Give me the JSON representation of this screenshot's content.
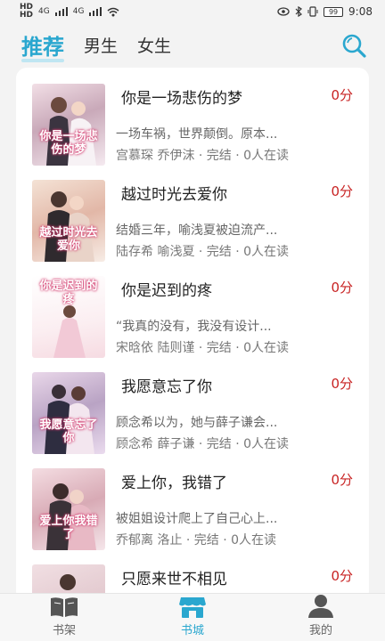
{
  "status_bar": {
    "left": [
      "HD",
      "4G",
      "4G"
    ],
    "battery": "99",
    "time": "9:08"
  },
  "header": {
    "tabs": [
      {
        "label": "推荐",
        "active": true
      },
      {
        "label": "男生",
        "active": false
      },
      {
        "label": "女生",
        "active": false
      }
    ],
    "accent_color": "#2aa7cf"
  },
  "books": [
    {
      "title": "你是一场悲伤的梦",
      "price": "0分",
      "desc": "一场车祸，世界颠倒。原本...",
      "meta": "宫慕琛 乔伊沫 · 完结 · 0人在读",
      "cover_text": "你是一场悲伤的梦"
    },
    {
      "title": "越过时光去爱你",
      "price": "0分",
      "desc": "结婚三年，喻浅夏被迫流产...",
      "meta": "陆存希 喻浅夏 · 完结 · 0人在读",
      "cover_text": "越过时光去爱你"
    },
    {
      "title": "你是迟到的疼",
      "price": "0分",
      "desc": "“我真的没有，我没有设计...",
      "meta": "宋晗依 陆则谨 · 完结 · 0人在读",
      "cover_text": "你是迟到的疼"
    },
    {
      "title": "我愿意忘了你",
      "price": "0分",
      "desc": "顾念希以为，她与薛子谦会...",
      "meta": "顾念希 薛子谦 · 完结 · 0人在读",
      "cover_text": "我愿意忘了你"
    },
    {
      "title": "爱上你，我错了",
      "price": "0分",
      "desc": "被姐姐设计爬上了自己心上...",
      "meta": "乔郁离 洛止 · 完结 · 0人在读",
      "cover_text": "爱上你我错了"
    },
    {
      "title": "只愿来世不相见",
      "price": "0分",
      "desc": "",
      "meta": "",
      "cover_text": ""
    }
  ],
  "bottom_nav": [
    {
      "label": "书架",
      "icon": "book-icon",
      "active": false
    },
    {
      "label": "书城",
      "icon": "store-icon",
      "active": true
    },
    {
      "label": "我的",
      "icon": "person-icon",
      "active": false
    }
  ]
}
